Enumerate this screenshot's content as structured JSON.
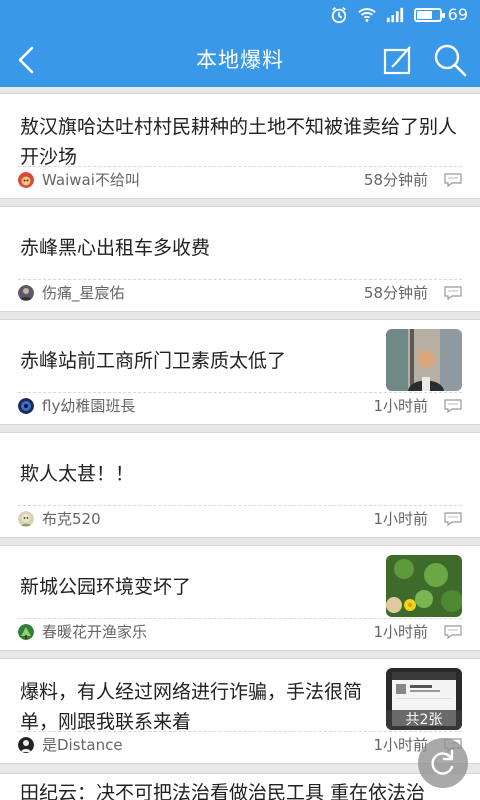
{
  "status_bar": {
    "battery_level": "69",
    "battery_fill": 0.69
  },
  "header": {
    "title": "本地爆料"
  },
  "posts": [
    {
      "title": "敖汉旗哈达吐村村民耕种的土地不知被谁卖给了别人开沙场",
      "author": "Waiwai不给叫",
      "time": "58分钟前"
    },
    {
      "title": "赤峰黑心出租车多收费",
      "author": "伤痛_星宸佑",
      "time": "58分钟前"
    },
    {
      "title": "赤峰站前工商所门卫素质太低了",
      "author": "fly幼稚園班長",
      "time": "1小时前"
    },
    {
      "title": "欺人太甚！！",
      "author": "布克520",
      "time": "1小时前"
    },
    {
      "title": "新城公园环境变坏了",
      "author": "春暖花开渔家乐",
      "time": "1小时前"
    },
    {
      "title": "爆料，有人经过网络进行诈骗，手法很简单，刚跟我联系来着",
      "author": "是Distance",
      "time": "1小时前",
      "image_count": "共2张"
    },
    {
      "title": "田纪云：决不可把法治看做治民工具 重在依法治"
    }
  ],
  "icons": {
    "alarm": "alarm-icon",
    "wifi": "wifi-icon",
    "signal": "signal-icon",
    "battery": "battery-icon",
    "back": "back-arrow-icon",
    "compose": "compose-icon",
    "search": "search-icon",
    "comment": "comment-icon",
    "refresh": "refresh-icon"
  },
  "colors": {
    "primary": "#3a98e8",
    "background": "#e8e8e8",
    "text": "#222222",
    "meta": "#666666"
  }
}
